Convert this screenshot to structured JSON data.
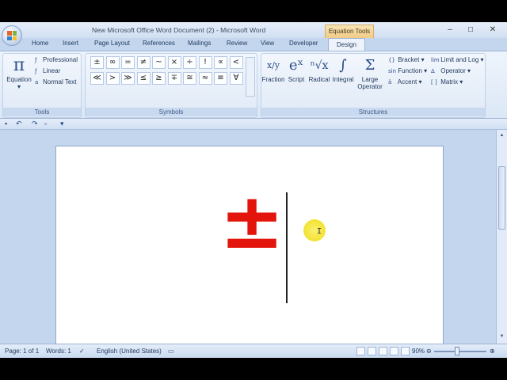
{
  "window": {
    "title": "New Microsoft Office Word Document (2) - Microsoft Word",
    "context_tab": "Equation Tools",
    "controls": [
      "–",
      "□",
      "✕"
    ]
  },
  "tabs": [
    "Home",
    "Insert",
    "Page Layout",
    "References",
    "Mailings",
    "Review",
    "View",
    "Developer",
    "Design"
  ],
  "active_tab": "Design",
  "ribbon": {
    "tools": {
      "label": "Tools",
      "equation_label": "Equation",
      "equation_glyph": "π",
      "options": [
        "Professional",
        "Linear",
        "Normal Text"
      ]
    },
    "symbols": {
      "label": "Symbols",
      "row1": [
        "±",
        "∞",
        "=",
        "≠",
        "~",
        "×",
        "÷",
        "!",
        "∝",
        "<"
      ],
      "row2": [
        "≪",
        ">",
        "≫",
        "≤",
        "≥",
        "∓",
        "≅",
        "≈",
        "≡",
        "∀"
      ]
    },
    "structures": {
      "label": "Structures",
      "buttons": [
        {
          "label": "Fraction",
          "glyph": "x/y"
        },
        {
          "label": "Script",
          "glyph": "eˣ"
        },
        {
          "label": "Radical",
          "glyph": "ⁿ√x"
        },
        {
          "label": "Integral",
          "glyph": "∫"
        },
        {
          "label": "Large Operator",
          "glyph": "Σ"
        }
      ],
      "small": [
        "Bracket",
        "Function",
        "Accent",
        "Limit and Log",
        "Operator",
        "Matrix"
      ]
    }
  },
  "document": {
    "equation_text": "±"
  },
  "statusbar": {
    "page": "Page: 1 of 1",
    "words": "Words: 1",
    "language": "English (United States)",
    "zoom": "90%"
  }
}
